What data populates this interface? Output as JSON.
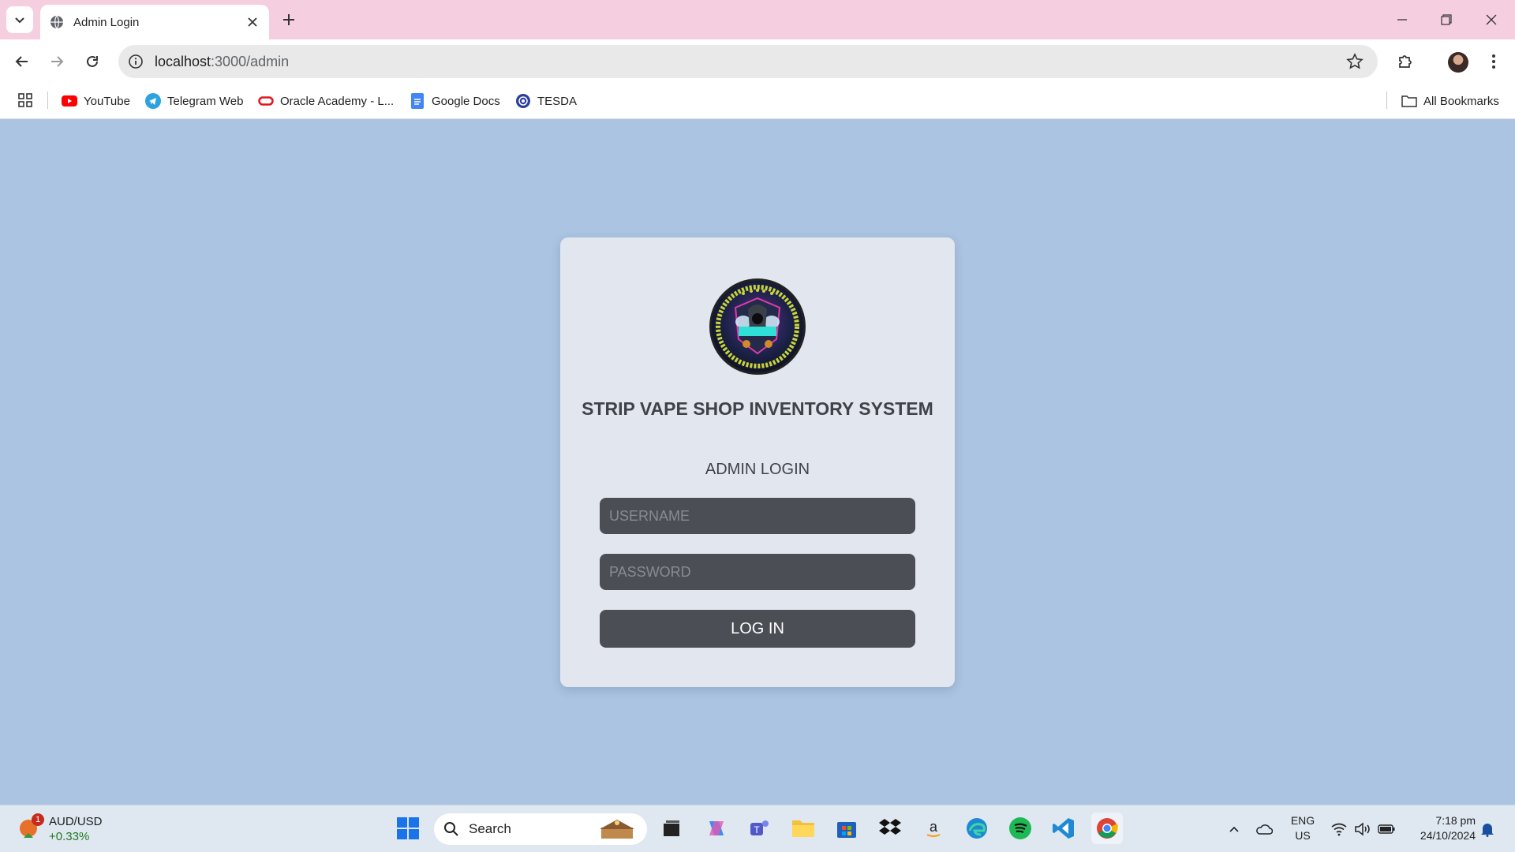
{
  "browser": {
    "tab_title": "Admin Login",
    "url_host": "localhost",
    "url_path": ":3000/admin"
  },
  "bookmarks": [
    {
      "label": "YouTube",
      "icon": "youtube-icon",
      "color": "#ff0000"
    },
    {
      "label": "Telegram Web",
      "icon": "telegram-icon",
      "color": "#2aa3df"
    },
    {
      "label": "Oracle Academy - L...",
      "icon": "oracle-icon",
      "color": "#e0161c"
    },
    {
      "label": "Google Docs",
      "icon": "google-docs-icon",
      "color": "#4285f4"
    },
    {
      "label": "TESDA",
      "icon": "tesda-icon",
      "color": "#2b3f9e"
    }
  ],
  "all_bookmarks_label": "All Bookmarks",
  "login": {
    "title": "STRIP VAPE SHOP INVENTORY SYSTEM",
    "subtitle": "ADMIN LOGIN",
    "username_placeholder": "USERNAME",
    "password_placeholder": "PASSWORD",
    "button_label": "LOG IN"
  },
  "taskbar": {
    "widget_symbol": "AUD/USD",
    "widget_change": "+0.33%",
    "widget_badge": "1",
    "search_placeholder": "Search",
    "lang_line1": "ENG",
    "lang_line2": "US",
    "time": "7:18 pm",
    "date": "24/10/2024"
  },
  "colors": {
    "page_background": "#aac4e2",
    "card_background": "#e2e6ee",
    "input_background": "#4b4e55",
    "tabbar_background": "#f5cfe0"
  }
}
